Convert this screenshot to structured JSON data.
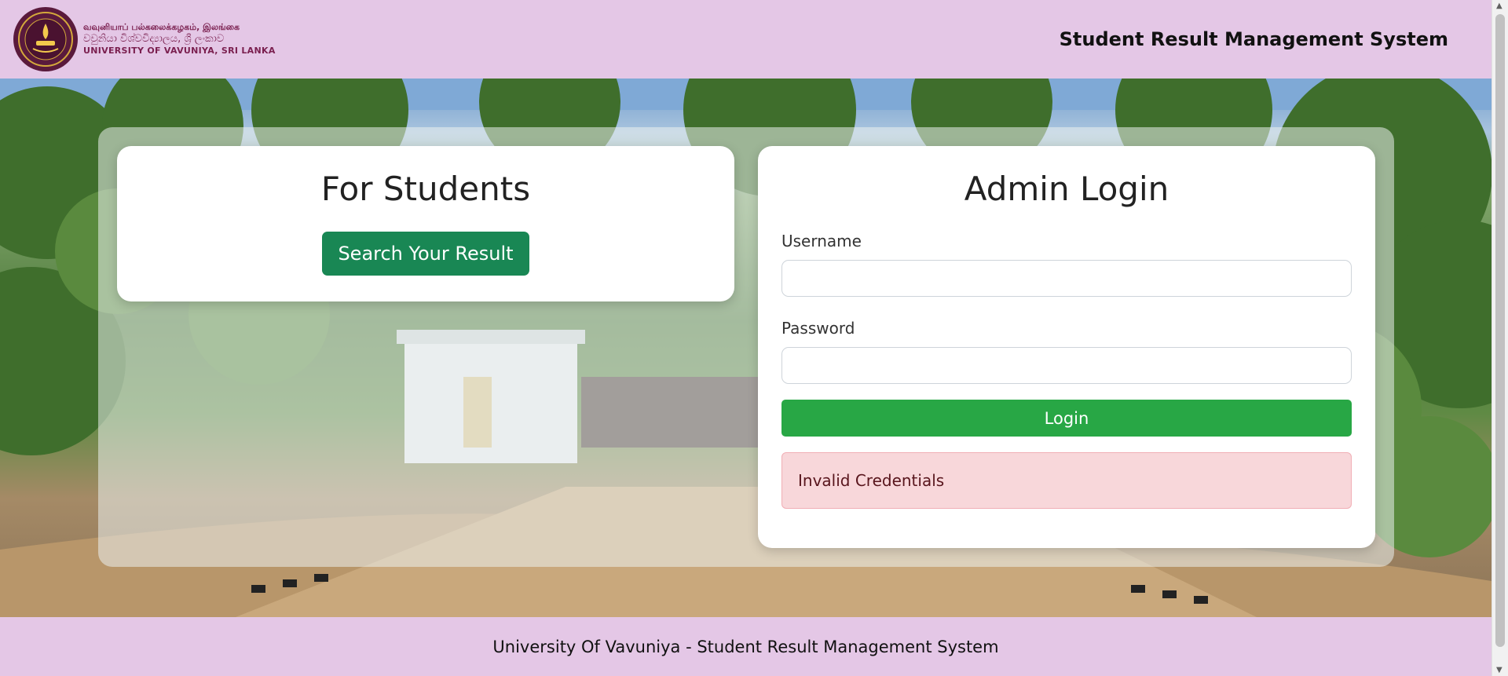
{
  "header": {
    "brand": {
      "line1": "வவுனியாப் பல்கலைக்கழகம், இலங்கை",
      "line2": "වවුනියා විශ්වවිද්‍යාලය, ශ්‍රී ලංකාව",
      "line3": "UNIVERSITY OF VAVUNIYA, SRI LANKA"
    },
    "system_title": "Student Result Management System"
  },
  "students": {
    "heading": "For Students",
    "search_button": "Search Your Result"
  },
  "admin": {
    "heading": "Admin Login",
    "username_label": "Username",
    "username_value": "",
    "password_label": "Password",
    "password_value": "",
    "login_button": "Login",
    "error_message": "Invalid Credentials"
  },
  "footer": {
    "text": "University Of Vavuniya - Student Result Management System"
  },
  "colors": {
    "header_bg": "#e4c7e6",
    "search_button": "#198754",
    "login_button": "#28a745",
    "alert_bg": "#f8d7da",
    "brand_text": "#7a1f4f"
  },
  "icons": {
    "logo": "university-seal",
    "scroll_up": "arrow-up",
    "scroll_down": "arrow-down"
  }
}
